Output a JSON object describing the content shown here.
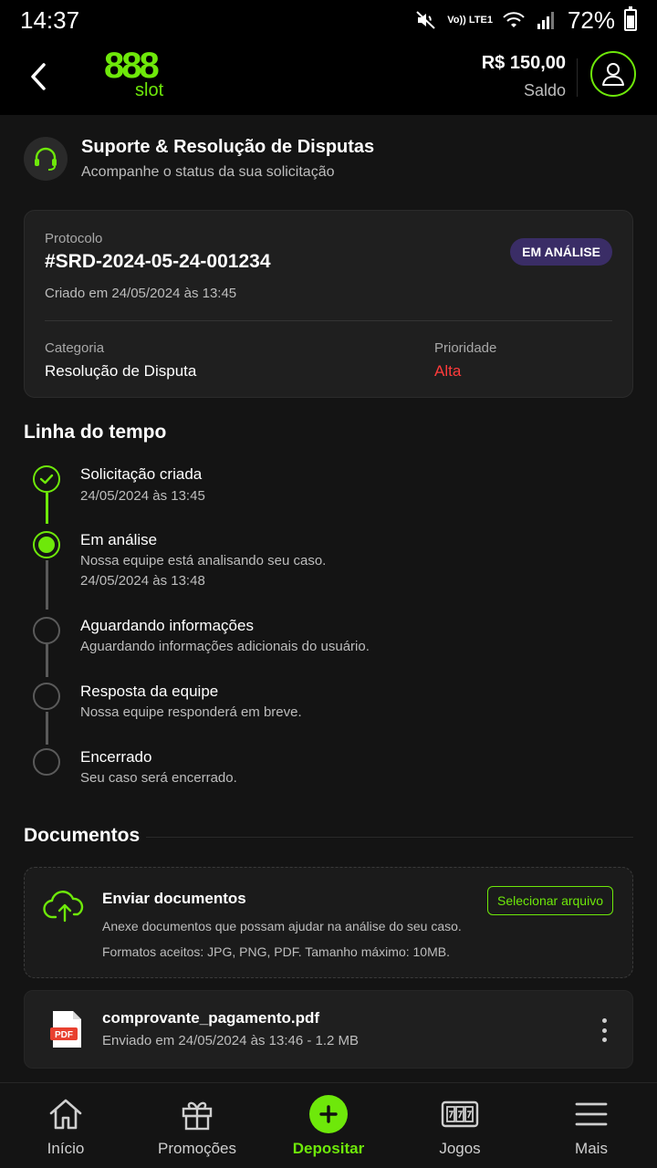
{
  "status_bar": {
    "time": "14:37",
    "lte_label": "Vo)) LTE1",
    "battery": "72%",
    "battery_level": 0.72
  },
  "header": {
    "logo_number": "888",
    "logo_word": "slot",
    "balance_amount": "R$ 150,00",
    "balance_label": "Saldo"
  },
  "support": {
    "title": "Suporte & Resolução de Disputas",
    "subtitle": "Acompanhe o status da sua solicitação"
  },
  "protocol": {
    "label": "Protocolo",
    "number": "#SRD-2024-05-24-001234",
    "created": "Criado em 24/05/2024 às 13:45",
    "status_badge": "EM ANÁLISE",
    "category_label": "Categoria",
    "category_value": "Resolução de Disputa",
    "priority_label": "Prioridade",
    "priority_value": "Alta"
  },
  "timeline": {
    "title": "Linha do tempo",
    "steps": [
      {
        "title": "Solicitação criada",
        "line1": "24/05/2024 às 13:45",
        "line2": "",
        "state": "done"
      },
      {
        "title": "Em análise",
        "line1": "Nossa equipe está analisando seu caso.",
        "line2": "24/05/2024 às 13:48",
        "state": "active"
      },
      {
        "title": "Aguardando informações",
        "line1": "Aguardando informações adicionais do usuário.",
        "line2": "",
        "state": "pending"
      },
      {
        "title": "Resposta da equipe",
        "line1": "Nossa equipe responderá em breve.",
        "line2": "",
        "state": "pending"
      },
      {
        "title": "Encerrado",
        "line1": "Seu caso será encerrado.",
        "line2": "",
        "state": "pending"
      }
    ]
  },
  "documents": {
    "title": "Documentos",
    "upload_title": "Enviar documentos",
    "upload_desc": "Anexe documentos que possam ajudar na análise do seu caso.",
    "upload_formats": "Formatos aceitos: JPG, PNG, PDF. Tamanho máximo: 10MB.",
    "select_button": "Selecionar arquivo",
    "file_icon_label": "PDF",
    "file_name": "comprovante_pagamento.pdf",
    "file_meta": "Enviado em 24/05/2024 às 13:46 - 1.2 MB"
  },
  "bottom_nav": {
    "items": [
      {
        "label": "Início",
        "icon": "home-icon"
      },
      {
        "label": "Promoções",
        "icon": "gift-icon"
      },
      {
        "label": "Depositar",
        "icon": "plus-icon"
      },
      {
        "label": "Jogos",
        "icon": "slot-machine-icon"
      },
      {
        "label": "Mais",
        "icon": "menu-icon"
      }
    ],
    "active_index": 2
  },
  "colors": {
    "accent": "#6ee80a",
    "background": "#141414",
    "card": "#1f1f1f",
    "priority_high": "#ff3b3b",
    "badge_bg": "#3a2d66"
  }
}
